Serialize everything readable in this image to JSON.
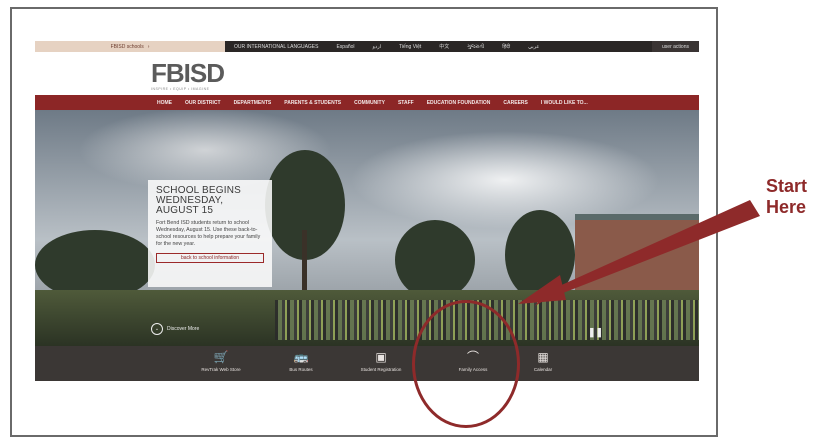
{
  "topbar": {
    "school": "FBISD schools",
    "languages": [
      "OUR INTERNATIONAL LANGUAGES",
      "Español",
      "اردو",
      "Tiếng Việt",
      "中文",
      "ગુજરાતી",
      "हिंदी",
      "عربي"
    ],
    "actions": "user actions"
  },
  "header": {
    "logo": "FBISD",
    "tagline": "INSPIRE • EQUIP • IMAGINE"
  },
  "nav": {
    "items": [
      "HOME",
      "OUR DISTRICT",
      "DEPARTMENTS",
      "PARENTS & STUDENTS",
      "COMMUNITY",
      "STAFF",
      "EDUCATION FOUNDATION",
      "CAREERS",
      "I WOULD LIKE TO..."
    ]
  },
  "hero": {
    "headline": "SCHOOL BEGINS WEDNESDAY, AUGUST 15",
    "body": "Fort Bend ISD students return to school Wednesday, August 15. Use these back-to-school resources to help prepare your family for the new year.",
    "button": "back to school information",
    "discover": "Discover More"
  },
  "quicklinks": [
    {
      "label": "RevTrak Web Store",
      "icon": "cart-icon",
      "glyph": "🛒"
    },
    {
      "label": "Bus Routes",
      "icon": "bus-icon",
      "glyph": "🚌"
    },
    {
      "label": "Student Registration",
      "icon": "registration-icon",
      "glyph": "▣"
    },
    {
      "label": "Family Access",
      "icon": "skyward-icon",
      "glyph": "⌒"
    },
    {
      "label": "Calendar",
      "icon": "calendar-icon",
      "glyph": "▦"
    }
  ],
  "annotation": {
    "line1": "Start",
    "line2": "Here",
    "color": "#8e2a2a"
  },
  "colors": {
    "nav": "#8c2626",
    "topbar": "#2a2625",
    "quickbar": "#3b3735"
  }
}
